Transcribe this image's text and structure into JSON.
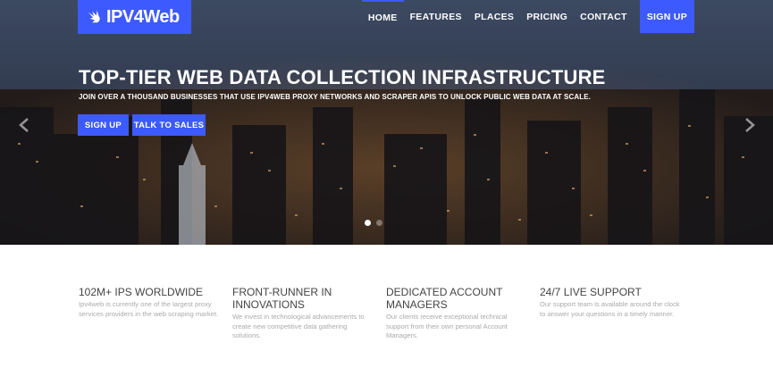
{
  "brand": {
    "name": "IPV4Web",
    "accent": "#3d5afe"
  },
  "nav": {
    "items": [
      {
        "label": "HOME"
      },
      {
        "label": "FEATURES"
      },
      {
        "label": "PLACES"
      },
      {
        "label": "PRICING"
      },
      {
        "label": "CONTACT"
      }
    ],
    "signup_label": "SIGN UP"
  },
  "hero": {
    "title": "TOP-TIER WEB DATA COLLECTION INFRASTRUCTURE",
    "subtitle": "JOIN OVER A THOUSAND BUSINESSES THAT USE IPV4WEB PROXY NETWORKS AND SCRAPER APIS TO UNLOCK PUBLIC WEB DATA AT SCALE.",
    "signup_label": "SIGN UP",
    "sales_label": "TALK TO SALES",
    "slides": 2,
    "active_slide": 1
  },
  "features": [
    {
      "title": "102M+ IPS WORLDWIDE",
      "text": "Ipv4web is currently one of the largest proxy services providers in the web scraping market."
    },
    {
      "title": "FRONT-RUNNER IN INNOVATIONS",
      "text": "We invest in technological advancements to create new competitive data gathering solutions."
    },
    {
      "title": "DEDICATED ACCOUNT MANAGERS",
      "text": "Our clients receive exceptional technical support from their own personal Account Managers."
    },
    {
      "title": "24/7 LIVE SUPPORT",
      "text": "Our support team is available around the clock to answer your questions in a timely manner."
    }
  ]
}
